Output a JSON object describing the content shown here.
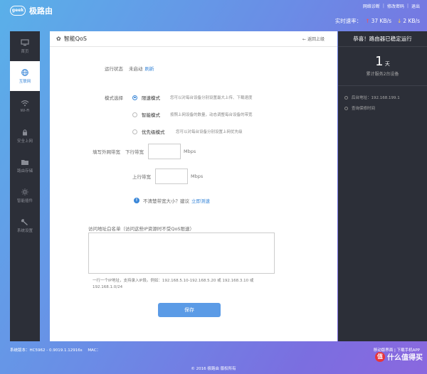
{
  "brand": {
    "logo_badge": "geek",
    "name": "极路由"
  },
  "top_links": {
    "diagnose": "网络诊断",
    "change_password": "修改密码",
    "logout": "退出"
  },
  "speed": {
    "label": "实时速率：",
    "up": "37 KB/s",
    "down": "2 KB/s"
  },
  "sidebar": {
    "items": [
      {
        "label": "首页",
        "icon": "monitor-icon",
        "active": false
      },
      {
        "label": "互联网",
        "icon": "globe-icon",
        "active": true
      },
      {
        "label": "Wi-Fi",
        "icon": "wifi-icon",
        "active": false
      },
      {
        "label": "安全上网",
        "icon": "lock-icon",
        "active": false
      },
      {
        "label": "路由存储",
        "icon": "folder-icon",
        "active": false
      },
      {
        "label": "智能插件",
        "icon": "sun-icon",
        "active": false
      },
      {
        "label": "系统设置",
        "icon": "wrench-icon",
        "active": false
      }
    ]
  },
  "main": {
    "title": "智能QoS",
    "back": "返回上级",
    "status_label": "运行状态",
    "status_value": "未启动",
    "refresh": "刷新",
    "mode_label": "模式选择",
    "modes": [
      {
        "name": "限速模式",
        "desc": "您可以对每台设备分别设置最大上传、下载速度",
        "selected": true
      },
      {
        "name": "智能模式",
        "desc": "按照上网设备的数量，动态调整每台设备的带宽",
        "selected": false
      },
      {
        "name": "优先级模式",
        "desc": "您可以对每台设备分别设置上网优先级",
        "selected": false
      }
    ],
    "bandwidth_label": "填写外网带宽",
    "down_label": "下行带宽",
    "up_label": "上行带宽",
    "unit": "Mbps",
    "unsure_text": "不清楚带宽大小？建议",
    "speed_test": "立即测速",
    "whitelist_label": "访问地址白名单（访问这些IP资源时不受QoS限速）",
    "whitelist_value": "",
    "hint": "一行一个IP地址，支持录入IP段。例如：192.168.5.10-192.168.5.20 或 192.168.3.10 或 192.168.1.0/24",
    "save": "保存"
  },
  "right_panel": {
    "headline": "恭喜！路由器已稳定运行",
    "days_num": "1",
    "days_unit": "天",
    "served": "累计服务2台设备",
    "wan_ip": "后台地址：192.168.199.1",
    "warranty": "查询保修时间"
  },
  "footer": {
    "version": "系统版本：HC5962 - 0.9019.1.12916s",
    "mac": "MAC：",
    "right_links": "移动版界面 | 下载手机APP",
    "copyright": "© 2016 极路由 版权所有",
    "watermark": "什么值得买",
    "watermark_badge": "值"
  }
}
